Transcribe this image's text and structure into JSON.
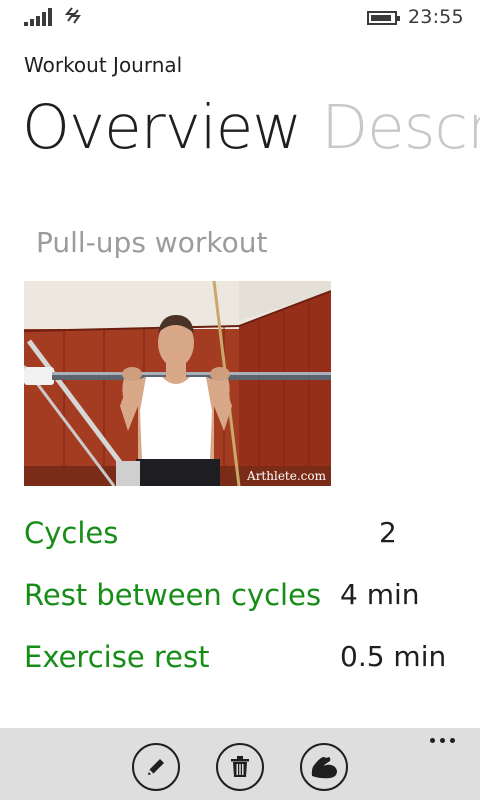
{
  "status_bar": {
    "time": "23:55",
    "icons": [
      "signal-strength-icon",
      "data-connection-icon",
      "battery-icon"
    ]
  },
  "app": {
    "title": "Workout Journal"
  },
  "pivot": {
    "items": [
      {
        "label": "Overview",
        "active": true
      },
      {
        "label": "Description",
        "active": false
      }
    ]
  },
  "workout": {
    "name": "Pull-ups workout",
    "image_watermark": "Arthlete.com",
    "stats": [
      {
        "label": "Cycles",
        "value": "2"
      },
      {
        "label": "Rest between cycles",
        "value": "4 min"
      },
      {
        "label": "Exercise rest",
        "value": "0.5 min"
      }
    ]
  },
  "app_bar": {
    "buttons": [
      "edit-icon",
      "delete-icon",
      "muscle-icon"
    ],
    "more_icon": "more-options-icon"
  },
  "colors": {
    "accent": "#168d16",
    "app_bar_background": "#dedede",
    "inactive_text": "#9c9c9c"
  }
}
